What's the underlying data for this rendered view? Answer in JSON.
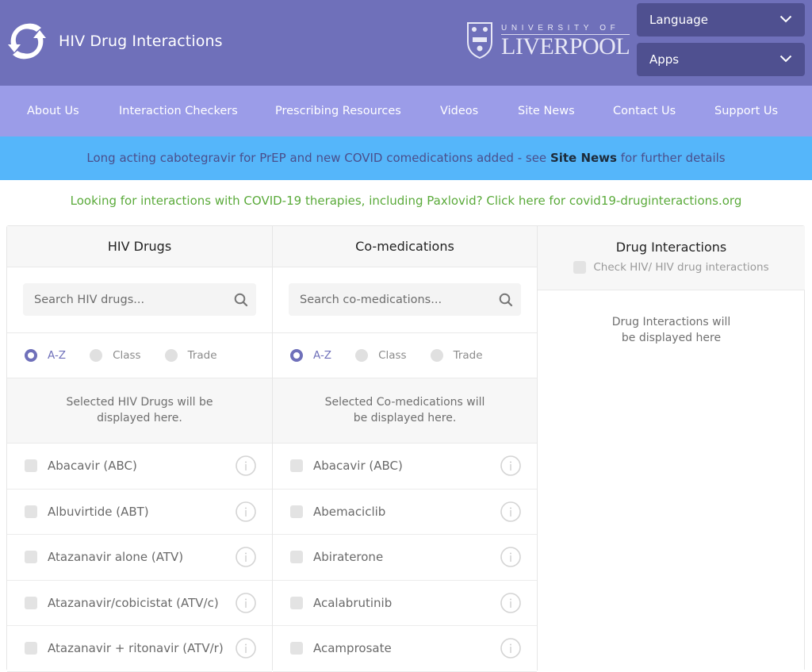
{
  "header": {
    "title": "HIV Drug Interactions",
    "university_small": "UNIVERSITY OF",
    "university_big": "LIVERPOOL",
    "language_label": "Language",
    "apps_label": "Apps"
  },
  "nav": {
    "items": [
      {
        "label": "About Us"
      },
      {
        "label": "Interaction Checkers"
      },
      {
        "label": "Prescribing Resources"
      },
      {
        "label": "Videos"
      },
      {
        "label": "Site News"
      },
      {
        "label": "Contact Us"
      },
      {
        "label": "Support Us"
      }
    ]
  },
  "banner": {
    "text_before": "Long acting cabotegravir for PrEP and new COVID comedications added - see ",
    "link": "Site News",
    "text_after": " for further details"
  },
  "covid_link": "Looking for interactions with COVID-19 therapies, including Paxlovid? Click here for covid19-druginteractions.org",
  "hiv_panel": {
    "title": "HIV Drugs",
    "search_placeholder": "Search HIV drugs...",
    "sort_options": [
      {
        "label": "A-Z",
        "selected": true
      },
      {
        "label": "Class",
        "selected": false
      },
      {
        "label": "Trade",
        "selected": false
      }
    ],
    "selected_placeholder": "Selected HIV Drugs will be displayed here.",
    "drugs": [
      "Abacavir (ABC)",
      "Albuvirtide (ABT)",
      "Atazanavir alone (ATV)",
      "Atazanavir/cobicistat (ATV/c)",
      "Atazanavir + ritonavir (ATV/r)"
    ]
  },
  "comed_panel": {
    "title": "Co-medications",
    "search_placeholder": "Search co-medications...",
    "sort_options": [
      {
        "label": "A-Z",
        "selected": true
      },
      {
        "label": "Class",
        "selected": false
      },
      {
        "label": "Trade",
        "selected": false
      }
    ],
    "selected_placeholder": "Selected Co-medications will be displayed here.",
    "drugs": [
      "Abacavir (ABC)",
      "Abemaciclib",
      "Abiraterone",
      "Acalabrutinib",
      "Acamprosate"
    ]
  },
  "interactions_panel": {
    "title": "Drug Interactions",
    "check_label": "Check HIV/ HIV drug interactions",
    "empty_text": "Drug Interactions will be displayed here"
  },
  "colors": {
    "header_bg": "#6f70ba",
    "nav_bg": "#9b9ce8",
    "banner_bg": "#55b6fa",
    "select_bg": "#4f5090",
    "covid_link": "#5aaa3a",
    "accent": "#6f70ba"
  }
}
